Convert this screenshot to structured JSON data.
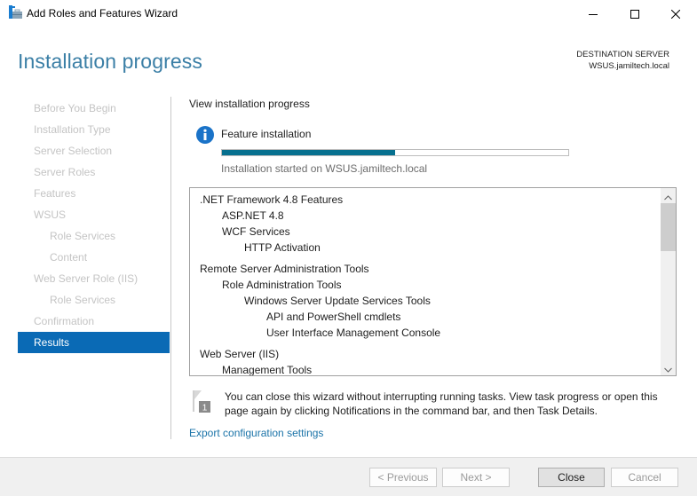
{
  "window": {
    "title": "Add Roles and Features Wizard",
    "app_icon": "server-manager-wizard-icon",
    "controls": {
      "minimize": "minimize-icon",
      "maximize": "maximize-icon",
      "close": "close-icon"
    }
  },
  "header": {
    "page_title": "Installation progress",
    "destination_label": "DESTINATION SERVER",
    "destination_value": "WSUS.jamiltech.local"
  },
  "sidebar": {
    "items": [
      {
        "label": "Before You Begin",
        "level": 0,
        "active": false
      },
      {
        "label": "Installation Type",
        "level": 0,
        "active": false
      },
      {
        "label": "Server Selection",
        "level": 0,
        "active": false
      },
      {
        "label": "Server Roles",
        "level": 0,
        "active": false
      },
      {
        "label": "Features",
        "level": 0,
        "active": false
      },
      {
        "label": "WSUS",
        "level": 0,
        "active": false
      },
      {
        "label": "Role Services",
        "level": 1,
        "active": false
      },
      {
        "label": "Content",
        "level": 1,
        "active": false
      },
      {
        "label": "Web Server Role (IIS)",
        "level": 0,
        "active": false
      },
      {
        "label": "Role Services",
        "level": 1,
        "active": false
      },
      {
        "label": "Confirmation",
        "level": 0,
        "active": false
      },
      {
        "label": "Results",
        "level": 0,
        "active": true
      }
    ]
  },
  "main": {
    "section_title": "View installation progress",
    "feature": {
      "icon": "info-icon",
      "label": "Feature installation",
      "progress_percent": 50,
      "status": "Installation started on WSUS.jamiltech.local"
    },
    "results": [
      {
        "label": ".NET Framework 4.8 Features",
        "level": 0
      },
      {
        "label": "ASP.NET 4.8",
        "level": 1
      },
      {
        "label": "WCF Services",
        "level": 1
      },
      {
        "label": "HTTP Activation",
        "level": 2
      },
      {
        "label": "Remote Server Administration Tools",
        "level": 0
      },
      {
        "label": "Role Administration Tools",
        "level": 1
      },
      {
        "label": "Windows Server Update Services Tools",
        "level": 2
      },
      {
        "label": "API and PowerShell cmdlets",
        "level": 3
      },
      {
        "label": "User Interface Management Console",
        "level": 3
      },
      {
        "label": "Web Server (IIS)",
        "level": 0
      },
      {
        "label": "Management Tools",
        "level": 1
      }
    ],
    "notice": {
      "icon": "notification-flag-icon",
      "badge": "1",
      "text": "You can close this wizard without interrupting running tasks. View task progress or open this page again by clicking Notifications in the command bar, and then Task Details."
    },
    "export_link": "Export configuration settings"
  },
  "footer": {
    "previous": "< Previous",
    "next": "Next >",
    "close": "Close",
    "cancel": "Cancel"
  },
  "colors": {
    "accent": "#0a6ab5",
    "title": "#3b7fa6",
    "progress": "#06708f",
    "link": "#1a73a8",
    "disabled_text": "#c4c4c4"
  }
}
